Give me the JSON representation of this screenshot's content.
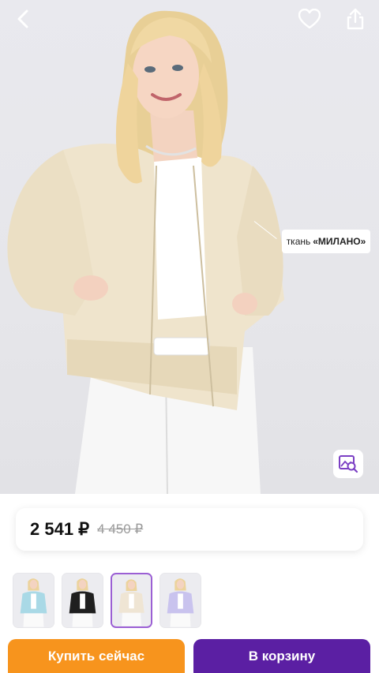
{
  "product": {
    "fabric_prefix": "ткань",
    "fabric_name": "«МИЛАНО»",
    "photo_alt": "product-photo"
  },
  "price": {
    "current": "2 541 ₽",
    "old": "4 450 ₽"
  },
  "thumbnails": [
    {
      "color": "#a9d9e6",
      "selected": false
    },
    {
      "color": "#1f1f1f",
      "selected": false
    },
    {
      "color": "#efe5d4",
      "selected": true
    },
    {
      "color": "#c9c3ee",
      "selected": false
    }
  ],
  "actions": {
    "buy_now": "Купить сейчас",
    "add_to_cart": "В корзину"
  },
  "colors": {
    "buy_now_bg": "#f7941d",
    "cart_bg": "#5b1fa3",
    "selected_border": "#9b5fd4"
  },
  "icons": {
    "back": "chevron-left-icon",
    "favorite": "heart-icon",
    "share": "share-icon",
    "visual_search": "image-search-icon"
  }
}
